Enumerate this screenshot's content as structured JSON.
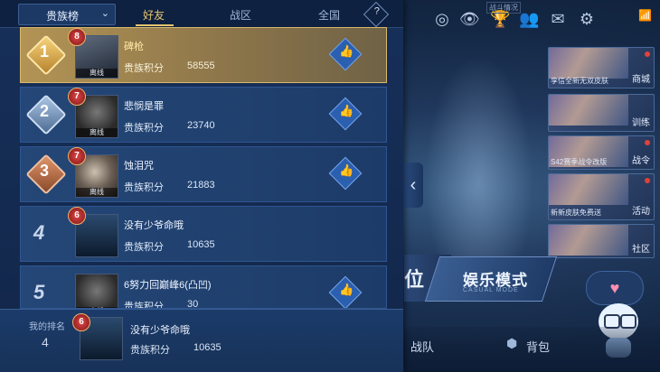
{
  "leaderboard": {
    "dropdown_label": "贵族榜",
    "tabs": [
      "好友",
      "战区",
      "全国"
    ],
    "help_symbol": "?",
    "score_label": "贵族积分",
    "rows": [
      {
        "rank": "1",
        "level": "8",
        "name": "碑枪",
        "score": "58555",
        "tag": "离线"
      },
      {
        "rank": "2",
        "level": "7",
        "name": "悲悯是罪",
        "score": "23740",
        "tag": "离线"
      },
      {
        "rank": "3",
        "level": "7",
        "name": "蚀泪咒",
        "score": "21883",
        "tag": "离线"
      },
      {
        "rank": "4",
        "level": "6",
        "name": "没有少爷命哦",
        "score": "10635",
        "tag": ""
      },
      {
        "rank": "5",
        "level": "",
        "name": "6努力回巅峰6(凸凹)",
        "score": "30",
        "tag": "离线"
      }
    ],
    "my_rank": {
      "title": "我的排名",
      "rank": "4",
      "level": "6",
      "name": "没有少爷命哦",
      "score": "10635"
    }
  },
  "topbar": {
    "label": "战斗情况",
    "icons": [
      "target-icon",
      "eye-icon",
      "trophy-icon",
      "friends-icon",
      "mail-icon",
      "gear-icon",
      "wifi-icon"
    ]
  },
  "side_menu": [
    {
      "label": "商城",
      "caption": "孪信全新无双皮肤"
    },
    {
      "label": "训练",
      "caption": ""
    },
    {
      "label": "战令",
      "caption": "S42赛季战令改版"
    },
    {
      "label": "活动",
      "caption": "新新皮肤免费送"
    },
    {
      "label": "社区",
      "caption": ""
    }
  ],
  "modes": {
    "left": "位",
    "entertainment": "娱乐模式",
    "entertainment_sub": "CASUAL MODE"
  },
  "bottom": {
    "team": "战队",
    "bag": "背包"
  }
}
